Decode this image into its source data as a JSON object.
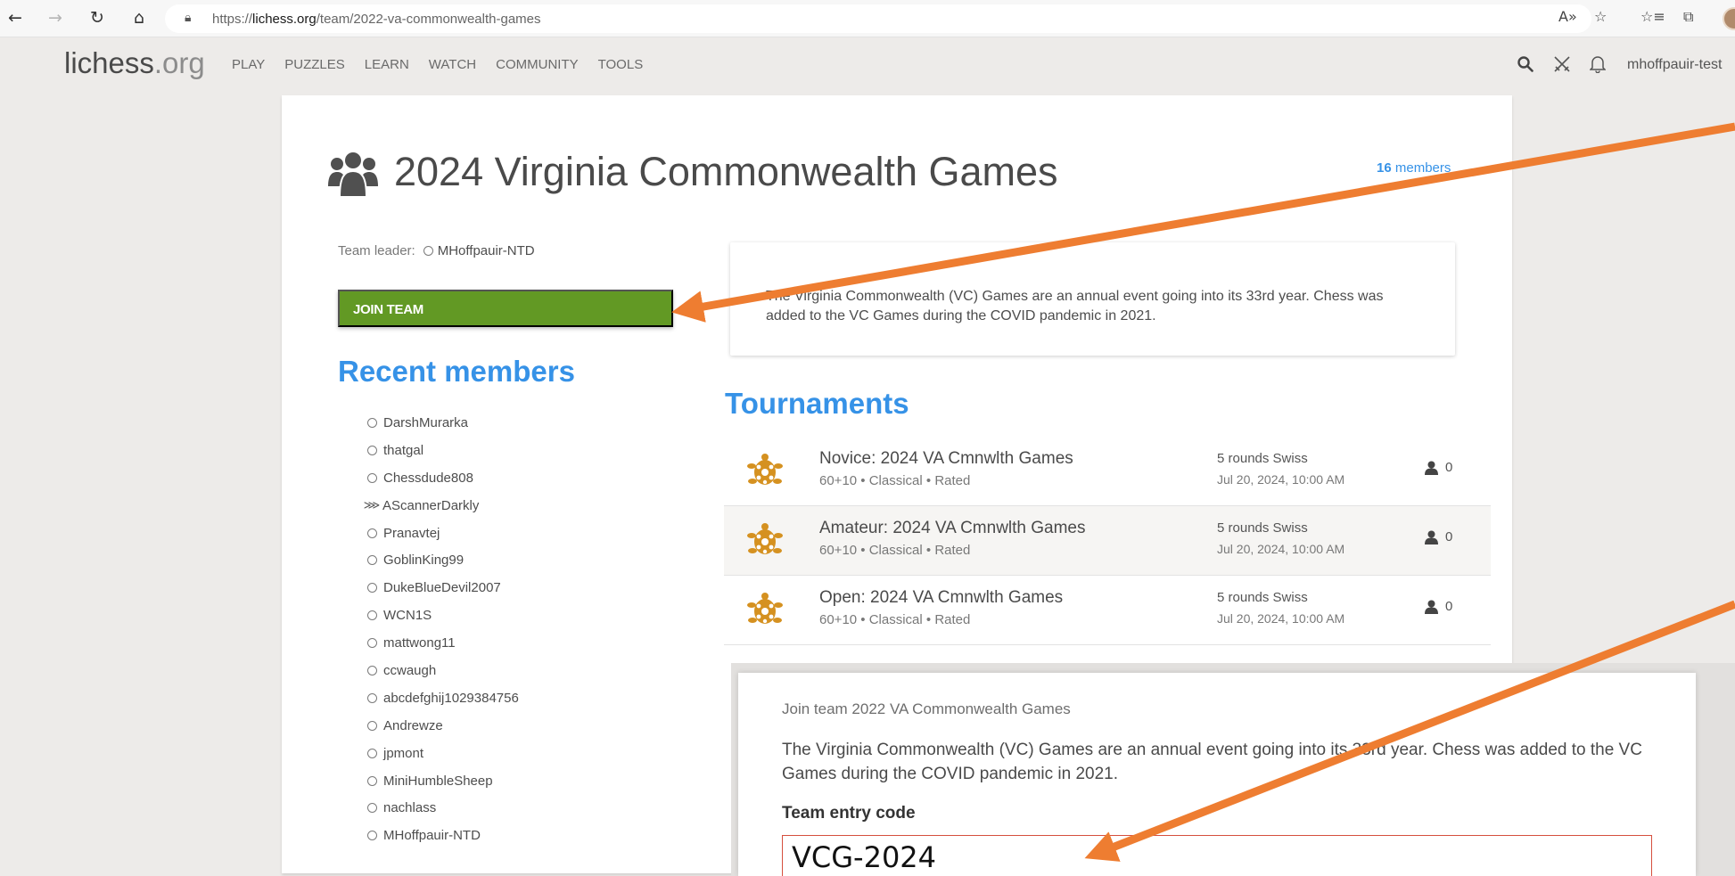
{
  "browser": {
    "url_prefix": "https://",
    "url_domain": "lichess.org",
    "url_path": "/team/2022-va-commonwealth-games",
    "icons": [
      "back-icon",
      "forward-icon",
      "refresh-icon",
      "home-icon",
      "lock-icon",
      "read-aloud-icon",
      "add-favorite-icon",
      "favorites-icon",
      "collections-icon",
      "profile-avatar"
    ]
  },
  "header": {
    "logo_main": "lichess",
    "logo_tld": ".org",
    "nav": [
      "PLAY",
      "PUZZLES",
      "LEARN",
      "WATCH",
      "COMMUNITY",
      "TOOLS"
    ],
    "username": "mhoffpauir-test",
    "icons": [
      "search-icon",
      "swords-icon",
      "bell-icon"
    ]
  },
  "team": {
    "title": "2024 Virginia Commonwealth Games",
    "members_count": "16",
    "members_label": " members",
    "leader_label": "Team leader:",
    "leader_name": "MHoffpauir-NTD",
    "join_button": "JOIN TEAM",
    "description": "The Virginia Commonwealth (VC) Games are an annual event going into its 33rd year. Chess was added to the VC Games during the COVID pandemic in 2021."
  },
  "recent_members": {
    "title": "Recent members",
    "members": [
      "DarshMurarka",
      "thatgal",
      "Chessdude808",
      "AScannerDarkly",
      "Pranavtej",
      "GoblinKing99",
      "DukeBlueDevil2007",
      "WCN1S",
      "mattwong11",
      "ccwaugh",
      "abcdefghij1029384756",
      "Andrewze",
      "jpmont",
      "MiniHumbleSheep",
      "nachlass",
      "MHoffpauir-NTD"
    ],
    "patron_member": "AScannerDarkly"
  },
  "tournaments": {
    "title": "Tournaments",
    "rows": [
      {
        "name": "Novice: 2024 VA Cmnwlth Games",
        "sub": "60+10 • Classical • Rated",
        "rounds": "5 rounds Swiss",
        "date": "Jul 20, 2024, 10:00 AM",
        "players": "0"
      },
      {
        "name": "Amateur: 2024 VA Cmnwlth Games",
        "sub": "60+10 • Classical • Rated",
        "rounds": "5 rounds Swiss",
        "date": "Jul 20, 2024, 10:00 AM",
        "players": "0"
      },
      {
        "name": "Open: 2024 VA Cmnwlth Games",
        "sub": "60+10 • Classical • Rated",
        "rounds": "5 rounds Swiss",
        "date": "Jul 20, 2024, 10:00 AM",
        "players": "0"
      }
    ]
  },
  "join_modal": {
    "title": "Join team 2022 VA Commonwealth Games",
    "description": "The Virginia Commonwealth (VC) Games are an annual event going into its 33rd year. Chess was added to the VC Games during the COVID pandemic in 2021.",
    "code_label": "Team entry code",
    "code_value": "VCG-2024"
  },
  "colors": {
    "accent_blue": "#3692e7",
    "join_green": "#629924",
    "annotation_arrow": "#ee7d31",
    "turtle_orange": "#d59120"
  }
}
